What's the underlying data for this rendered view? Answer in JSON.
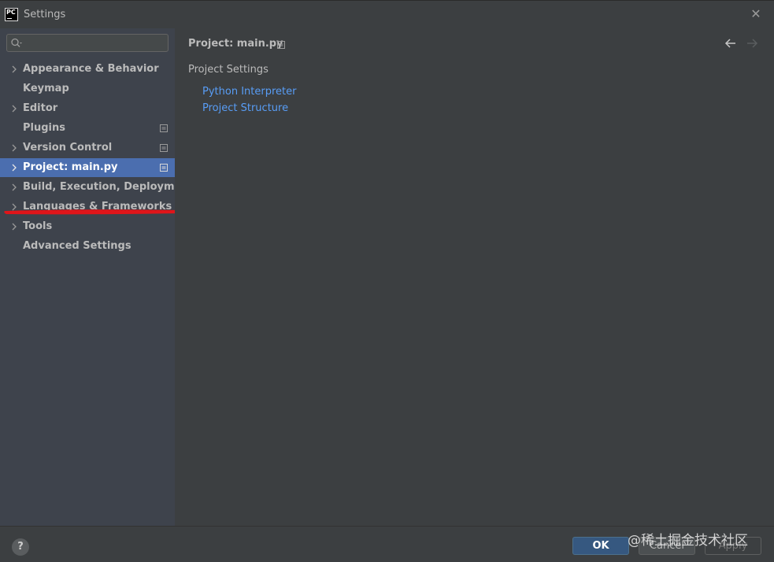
{
  "window": {
    "app_icon_text": "PC",
    "title": "Settings",
    "close_symbol": "✕"
  },
  "sidebar": {
    "search": {
      "value": "",
      "placeholder": ""
    },
    "items": [
      {
        "label": "Appearance & Behavior",
        "expandable": true,
        "selected": false,
        "has_marker": false
      },
      {
        "label": "Keymap",
        "expandable": false,
        "selected": false,
        "has_marker": false
      },
      {
        "label": "Editor",
        "expandable": true,
        "selected": false,
        "has_marker": false
      },
      {
        "label": "Plugins",
        "expandable": false,
        "selected": false,
        "has_marker": true
      },
      {
        "label": "Version Control",
        "expandable": true,
        "selected": false,
        "has_marker": true
      },
      {
        "label": "Project: main.py",
        "expandable": true,
        "selected": true,
        "has_marker": true
      },
      {
        "label": "Build, Execution, Deployment",
        "expandable": true,
        "selected": false,
        "has_marker": false
      },
      {
        "label": "Languages & Frameworks",
        "expandable": true,
        "selected": false,
        "has_marker": false
      },
      {
        "label": "Tools",
        "expandable": true,
        "selected": false,
        "has_marker": false
      },
      {
        "label": "Advanced Settings",
        "expandable": false,
        "selected": false,
        "has_marker": false
      }
    ]
  },
  "content": {
    "title": "Project: main.py",
    "section_label": "Project Settings",
    "links": [
      {
        "label": "Python Interpreter"
      },
      {
        "label": "Project Structure"
      }
    ]
  },
  "footer": {
    "help_label": "?",
    "ok_label": "OK",
    "cancel_label": "Cancel",
    "apply_label": "Apply"
  },
  "watermark": "@稀土掘金技术社区",
  "colors": {
    "selection": "#4b6eaf",
    "link": "#589df6",
    "annotation": "#e0151a"
  }
}
